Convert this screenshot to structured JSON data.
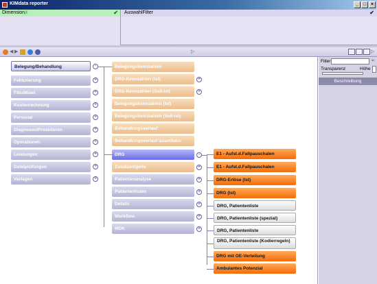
{
  "window": {
    "title": "KIMdata reporter",
    "buttons": [
      "_",
      "□",
      "×"
    ]
  },
  "filterbar": {
    "dimension_label": "Dimension",
    "auswahl_label": "AuswahlFilter"
  },
  "sidepanel": {
    "filter_label": "Filter",
    "transparenz_label": "Transparenz",
    "hoehe_label": "Höhe",
    "beschreibung_label": "Beschreibung"
  },
  "level1": [
    "Belegung/Behandlung",
    "Fakturierung",
    "Fibu/Mawi",
    "Kostenrechnung",
    "Personal",
    "Diagnosen/Prozeduren",
    "Operationen",
    "Leistungen",
    "Dateiprüfungen",
    "Vorlagen"
  ],
  "level2": [
    "Belegungskennzahlen",
    "DRG-Kennzahlen (Ist)",
    "DRG-Kennzahlen (Soll-Ist)",
    "Belegungskennzahlen (Ist)",
    "Belegungskennzahlen (Soll-Ist)",
    "Behandlungsverlauf",
    "Behandlungsverlauf quantitativ",
    "DRG",
    "Zusatzentgelte",
    "Patientenanalyse",
    "Patientenlisten",
    "Details",
    "Workflow",
    "MDK"
  ],
  "level3": [
    "E1 - Aufst.d.Fallpauschalen",
    "E1 - Aufst.d.Fallpauschalen",
    "DRG-Erlöse (Ist)",
    "DRG (Ist)",
    "DRG, Patientenliste",
    "DRG, Patientenliste (spezial)",
    "DRG, Patientenliste",
    "DRG, Patientenliste (Kodierregeln)",
    "DRG mit OE-Verteilung",
    "Ambulantes Potenzial"
  ]
}
